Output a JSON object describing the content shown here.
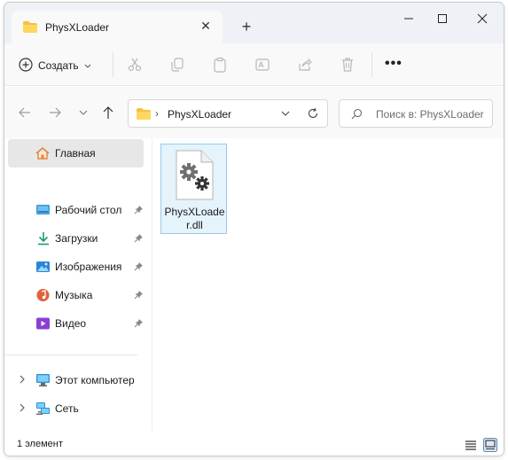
{
  "tab": {
    "title": "PhysXLoader"
  },
  "toolbar": {
    "create_label": "Создать",
    "icons": [
      "cut-icon",
      "copy-icon",
      "paste-icon",
      "rename-icon",
      "share-icon",
      "delete-icon"
    ],
    "more_label": "•••"
  },
  "address": {
    "path": "PhysXLoader",
    "separator": "›"
  },
  "search": {
    "placeholder": "Поиск в: PhysXLoader"
  },
  "sidebar": {
    "items": [
      {
        "label": "Главная",
        "icon": "home-icon",
        "selected": true
      },
      {
        "label": "Рабочий стол",
        "icon": "desktop-icon",
        "pinned": true
      },
      {
        "label": "Загрузки",
        "icon": "downloads-icon",
        "pinned": true
      },
      {
        "label": "Изображения",
        "icon": "pictures-icon",
        "pinned": true
      },
      {
        "label": "Музыка",
        "icon": "music-icon",
        "pinned": true
      },
      {
        "label": "Видео",
        "icon": "video-icon",
        "pinned": true
      },
      {
        "label": "Этот компьютер",
        "icon": "computer-icon",
        "expandable": true
      },
      {
        "label": "Сеть",
        "icon": "network-icon",
        "expandable": true
      }
    ]
  },
  "content": {
    "files": [
      {
        "name": "PhysXLoader.dll",
        "icon": "dll-file-icon",
        "selected": true
      }
    ]
  },
  "status": {
    "count_text": "1 элемент"
  },
  "colors": {
    "accent": "#0067c0",
    "folder": "#f4c242",
    "selection": "#e5f3fb",
    "selection_border": "#99c9ea"
  }
}
